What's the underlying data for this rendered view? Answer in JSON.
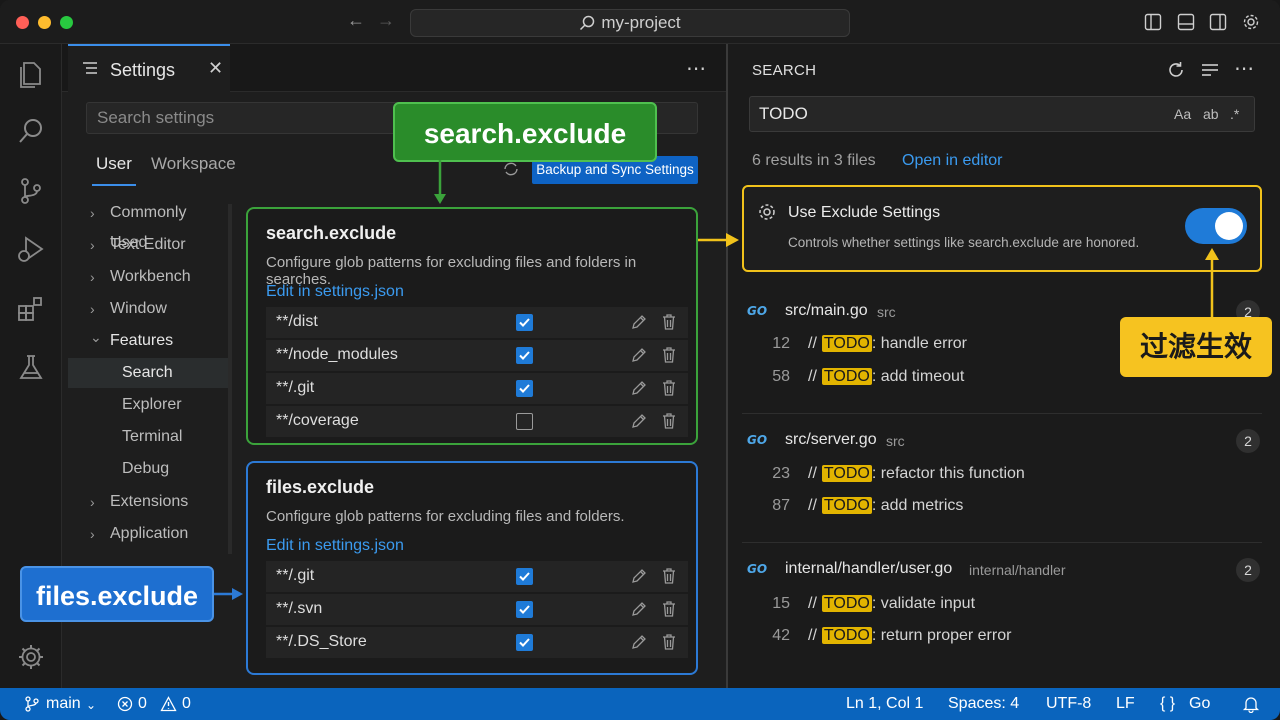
{
  "titlebar": {
    "command_center": "my-project"
  },
  "settings": {
    "tab_label": "Settings",
    "search_placeholder": "Search settings",
    "scope_tabs": [
      "User",
      "Workspace"
    ],
    "sync_button": "Backup and Sync Settings",
    "tree": [
      {
        "label": "Commonly Used",
        "chevron": "›"
      },
      {
        "label": "Text Editor",
        "chevron": "›"
      },
      {
        "label": "Workbench",
        "chevron": "›"
      },
      {
        "label": "Window",
        "chevron": "›"
      },
      {
        "label": "Features",
        "chevron": "⌄"
      },
      {
        "label": "Search"
      },
      {
        "label": "Explorer"
      },
      {
        "label": "Terminal"
      },
      {
        "label": "Debug"
      },
      {
        "label": "Extensions",
        "chevron": "›"
      },
      {
        "label": "Application",
        "chevron": "›"
      }
    ],
    "search_exclude": {
      "title": "search.exclude",
      "description": "Configure glob patterns for excluding files and folders in searches.",
      "edit_link": "Edit in settings.json",
      "patterns": [
        {
          "pattern": "**/dist",
          "checked": true
        },
        {
          "pattern": "**/node_modules",
          "checked": true
        },
        {
          "pattern": "**/.git",
          "checked": true
        },
        {
          "pattern": "**/coverage",
          "checked": false
        }
      ]
    },
    "files_exclude": {
      "title": "files.exclude",
      "description": "Configure glob patterns for excluding files and folders.",
      "edit_link": "Edit in settings.json",
      "patterns": [
        {
          "pattern": "**/.git",
          "checked": true
        },
        {
          "pattern": "**/.svn",
          "checked": true
        },
        {
          "pattern": "**/.DS_Store",
          "checked": true
        }
      ]
    }
  },
  "search": {
    "title": "SEARCH",
    "query": "TODO",
    "options": [
      "Aa",
      "ab",
      ".*"
    ],
    "summary": "6 results in 3 files",
    "open_in_editor": "Open in editor",
    "use_exclude": {
      "title": "Use Exclude Settings",
      "description": "Controls whether settings like search.exclude are honored.",
      "enabled": true
    },
    "results": [
      {
        "logo": "GO",
        "file": "src/main.go",
        "dir": "src",
        "count": "2",
        "matches": [
          {
            "line": "12",
            "prefix": "//",
            "keyword": "TODO",
            "rest": ": handle error"
          },
          {
            "line": "58",
            "prefix": "//",
            "keyword": "TODO",
            "rest": ": add timeout"
          }
        ]
      },
      {
        "logo": "GO",
        "file": "src/server.go",
        "dir": "src",
        "count": "2",
        "matches": [
          {
            "line": "23",
            "prefix": "//",
            "keyword": "TODO",
            "rest": ": refactor this function"
          },
          {
            "line": "87",
            "prefix": "//",
            "keyword": "TODO",
            "rest": ": add metrics"
          }
        ]
      },
      {
        "logo": "GO",
        "file": "internal/handler/user.go",
        "dir": "internal/handler",
        "count": "2",
        "matches": [
          {
            "line": "15",
            "prefix": "//",
            "keyword": "TODO",
            "rest": ": validate input"
          },
          {
            "line": "42",
            "prefix": "//",
            "keyword": "TODO",
            "rest": ": return proper error"
          }
        ]
      }
    ]
  },
  "statusbar": {
    "branch": "main",
    "errors": "0",
    "warnings": "0",
    "position": "Ln 1, Col 1",
    "spaces": "Spaces: 4",
    "encoding": "UTF-8",
    "eol": "LF",
    "language": "Go"
  },
  "callouts": {
    "search_exclude": "search.exclude",
    "files_exclude": "files.exclude",
    "filter_active": "过滤生效"
  },
  "colors": {
    "accent_blue": "#1f7bd8",
    "callout_green": "#2a8c2a",
    "callout_blue": "#1e6fd0",
    "callout_yellow": "#f6c320",
    "match_highlight": "#e2b400",
    "statusbar": "#0a64bd"
  }
}
